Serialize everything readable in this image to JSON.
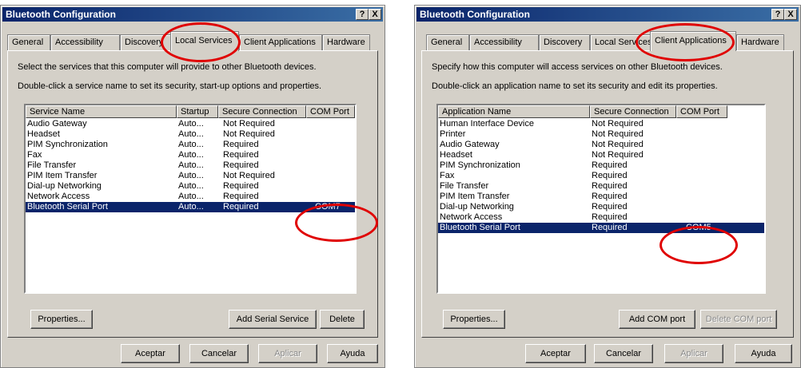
{
  "window1": {
    "title": "Bluetooth Configuration",
    "help_btn": "?",
    "close_btn": "X",
    "tabs": [
      "General",
      "Accessibility",
      "Discovery",
      "Local Services",
      "Client Applications",
      "Hardware"
    ],
    "active_tab": "Local Services",
    "desc1": "Select the services that this computer will provide to other Bluetooth devices.",
    "desc2": "Double-click a service name to set its security, start-up options and properties.",
    "columns": [
      "Service Name",
      "Startup",
      "Secure Connection",
      "COM Port"
    ],
    "rows": [
      [
        "Audio Gateway",
        "Auto...",
        "Not Required",
        ""
      ],
      [
        "Headset",
        "Auto...",
        "Not Required",
        ""
      ],
      [
        "PIM Synchronization",
        "Auto...",
        "Required",
        ""
      ],
      [
        "Fax",
        "Auto...",
        "Required",
        ""
      ],
      [
        "File Transfer",
        "Auto...",
        "Required",
        ""
      ],
      [
        "PIM Item Transfer",
        "Auto...",
        "Not Required",
        ""
      ],
      [
        "Dial-up Networking",
        "Auto...",
        "Required",
        ""
      ],
      [
        "Network Access",
        "Auto...",
        "Required",
        ""
      ],
      [
        "Bluetooth Serial Port",
        "Auto...",
        "Required",
        "COM7"
      ]
    ],
    "selected_row": 8,
    "buttons": {
      "properties": "Properties...",
      "add": "Add Serial Service",
      "delete": "Delete"
    },
    "dialog_buttons": {
      "ok": "Aceptar",
      "cancel": "Cancelar",
      "apply": "Aplicar",
      "help": "Ayuda"
    }
  },
  "window2": {
    "title": "Bluetooth Configuration",
    "help_btn": "?",
    "close_btn": "X",
    "tabs": [
      "General",
      "Accessibility",
      "Discovery",
      "Local Services",
      "Client Applications",
      "Hardware"
    ],
    "active_tab": "Client Applications",
    "desc1": "Specify how this computer will access services on other Bluetooth devices.",
    "desc2": "Double-click an application name to set its security and edit its properties.",
    "columns": [
      "Application Name",
      "Secure Connection",
      "COM Port"
    ],
    "rows": [
      [
        "Human Interface Device",
        "Not Required",
        ""
      ],
      [
        "Printer",
        "Not Required",
        ""
      ],
      [
        "Audio Gateway",
        "Not Required",
        ""
      ],
      [
        "Headset",
        "Not Required",
        ""
      ],
      [
        "PIM Synchronization",
        "Required",
        ""
      ],
      [
        "Fax",
        "Required",
        ""
      ],
      [
        "File Transfer",
        "Required",
        ""
      ],
      [
        "PIM Item Transfer",
        "Required",
        ""
      ],
      [
        "Dial-up Networking",
        "Required",
        ""
      ],
      [
        "Network Access",
        "Required",
        ""
      ],
      [
        "Bluetooth Serial Port",
        "Required",
        "COM5"
      ]
    ],
    "selected_row": 10,
    "buttons": {
      "properties": "Properties...",
      "add": "Add COM port",
      "delete": "Delete COM port"
    },
    "dialog_buttons": {
      "ok": "Aceptar",
      "cancel": "Cancelar",
      "apply": "Aplicar",
      "help": "Ayuda"
    }
  },
  "colors": {
    "selection": "#0a246a",
    "annotation": "#e00000",
    "face": "#d4d0c8"
  }
}
